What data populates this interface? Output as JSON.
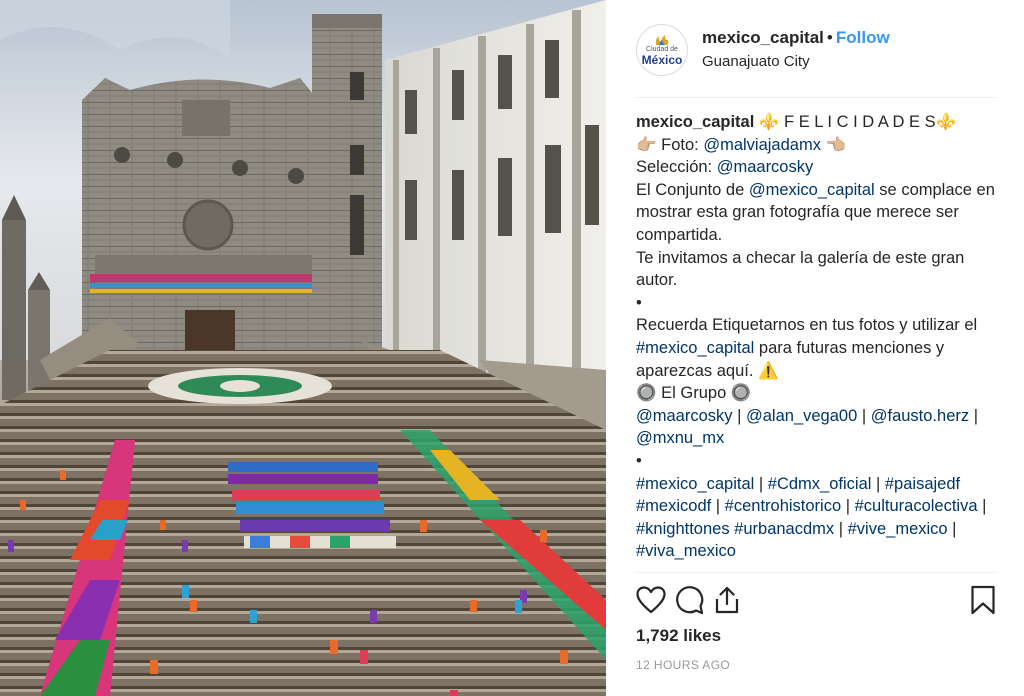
{
  "photo": {
    "alt": ""
  },
  "header": {
    "avatar_logo_top": "Ciudad de",
    "avatar_logo_word": "México",
    "username": "mexico_capital",
    "dot": "•",
    "follow_label": "Follow",
    "location": "Guanajuato City"
  },
  "caption": {
    "username": "mexico_capital",
    "segments": [
      {
        "t": " ⚜️ F E L I C I D A D E S⚜️\n👉🏼 Foto: "
      },
      {
        "t": "@malviajadamx",
        "link": true
      },
      {
        "t": " 👈🏼\nSelección: "
      },
      {
        "t": "@maarcosky",
        "link": true
      },
      {
        "t": "\nEl Conjunto de "
      },
      {
        "t": "@mexico_capital",
        "link": true
      },
      {
        "t": " se complace en mostrar esta gran fotografía que merece ser compartida.\nTe invitamos a checar la galería de este gran autor.\n•\nRecuerda Etiquetarnos en tus fotos y utilizar el "
      },
      {
        "t": "#mexico_capital",
        "link": true
      },
      {
        "t": " para futuras menciones y aparezcas aquí. ⚠️\n🔘 El Grupo 🔘\n"
      },
      {
        "t": "@maarcosky",
        "link": true
      },
      {
        "t": " | "
      },
      {
        "t": "@alan_vega00",
        "link": true
      },
      {
        "t": " | "
      },
      {
        "t": "@fausto.herz",
        "link": true
      },
      {
        "t": " | "
      },
      {
        "t": "@mxnu_mx",
        "link": true
      },
      {
        "t": "\n•\n"
      },
      {
        "t": "#mexico_capital",
        "link": true
      },
      {
        "t": " | "
      },
      {
        "t": "#Cdmx_oficial",
        "link": true
      },
      {
        "t": " | "
      },
      {
        "t": "#paisajedf",
        "link": true
      },
      {
        "t": " "
      },
      {
        "t": "#mexicodf",
        "link": true
      },
      {
        "t": " | "
      },
      {
        "t": "#centrohistorico",
        "link": true
      },
      {
        "t": " | "
      },
      {
        "t": "#culturacolectiva",
        "link": true
      },
      {
        "t": " | "
      },
      {
        "t": "#knighttones",
        "link": true
      },
      {
        "t": " "
      },
      {
        "t": "#urbanacdmx",
        "link": true
      },
      {
        "t": " | "
      },
      {
        "t": "#vive_mexico",
        "link": true
      },
      {
        "t": " | "
      },
      {
        "t": "#viva_mexico",
        "link": true
      }
    ]
  },
  "actions": {
    "like_icon": "heart-icon",
    "comment_icon": "comment-icon",
    "share_icon": "share-icon",
    "save_icon": "bookmark-icon"
  },
  "likes": "1,792 likes",
  "timestamp": "12 HOURS AGO",
  "colors": {
    "link": "#003569",
    "follow": "#3897f0",
    "muted": "#999999",
    "divider": "#efefef"
  }
}
